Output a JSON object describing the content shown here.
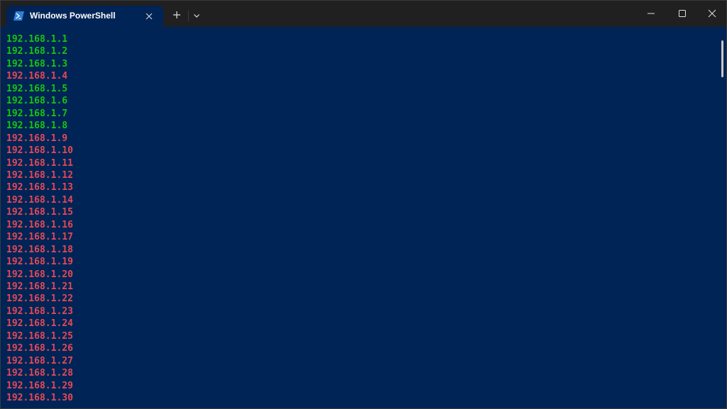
{
  "window": {
    "tab_title": "Windows PowerShell",
    "tab_icon": "powershell-icon",
    "new_tab_icon": "plus-icon",
    "dropdown_icon": "chevron-down-icon",
    "minimize_icon": "minimize-icon",
    "maximize_icon": "maximize-icon",
    "close_icon": "close-icon"
  },
  "colors": {
    "background": "#012456",
    "titlebar": "#202020",
    "reachable": "#16c60c",
    "unreachable": "#e74856"
  },
  "terminal": {
    "lines": [
      {
        "text": "192.168.1.1",
        "status": "reachable"
      },
      {
        "text": "192.168.1.2",
        "status": "reachable"
      },
      {
        "text": "192.168.1.3",
        "status": "reachable"
      },
      {
        "text": "192.168.1.4",
        "status": "unreachable"
      },
      {
        "text": "192.168.1.5",
        "status": "reachable"
      },
      {
        "text": "192.168.1.6",
        "status": "reachable"
      },
      {
        "text": "192.168.1.7",
        "status": "reachable"
      },
      {
        "text": "192.168.1.8",
        "status": "reachable"
      },
      {
        "text": "192.168.1.9",
        "status": "unreachable"
      },
      {
        "text": "192.168.1.10",
        "status": "unreachable"
      },
      {
        "text": "192.168.1.11",
        "status": "unreachable"
      },
      {
        "text": "192.168.1.12",
        "status": "unreachable"
      },
      {
        "text": "192.168.1.13",
        "status": "unreachable"
      },
      {
        "text": "192.168.1.14",
        "status": "unreachable"
      },
      {
        "text": "192.168.1.15",
        "status": "unreachable"
      },
      {
        "text": "192.168.1.16",
        "status": "unreachable"
      },
      {
        "text": "192.168.1.17",
        "status": "unreachable"
      },
      {
        "text": "192.168.1.18",
        "status": "unreachable"
      },
      {
        "text": "192.168.1.19",
        "status": "unreachable"
      },
      {
        "text": "192.168.1.20",
        "status": "unreachable"
      },
      {
        "text": "192.168.1.21",
        "status": "unreachable"
      },
      {
        "text": "192.168.1.22",
        "status": "unreachable"
      },
      {
        "text": "192.168.1.23",
        "status": "unreachable"
      },
      {
        "text": "192.168.1.24",
        "status": "unreachable"
      },
      {
        "text": "192.168.1.25",
        "status": "unreachable"
      },
      {
        "text": "192.168.1.26",
        "status": "unreachable"
      },
      {
        "text": "192.168.1.27",
        "status": "unreachable"
      },
      {
        "text": "192.168.1.28",
        "status": "unreachable"
      },
      {
        "text": "192.168.1.29",
        "status": "unreachable"
      },
      {
        "text": "192.168.1.30",
        "status": "unreachable"
      }
    ]
  }
}
